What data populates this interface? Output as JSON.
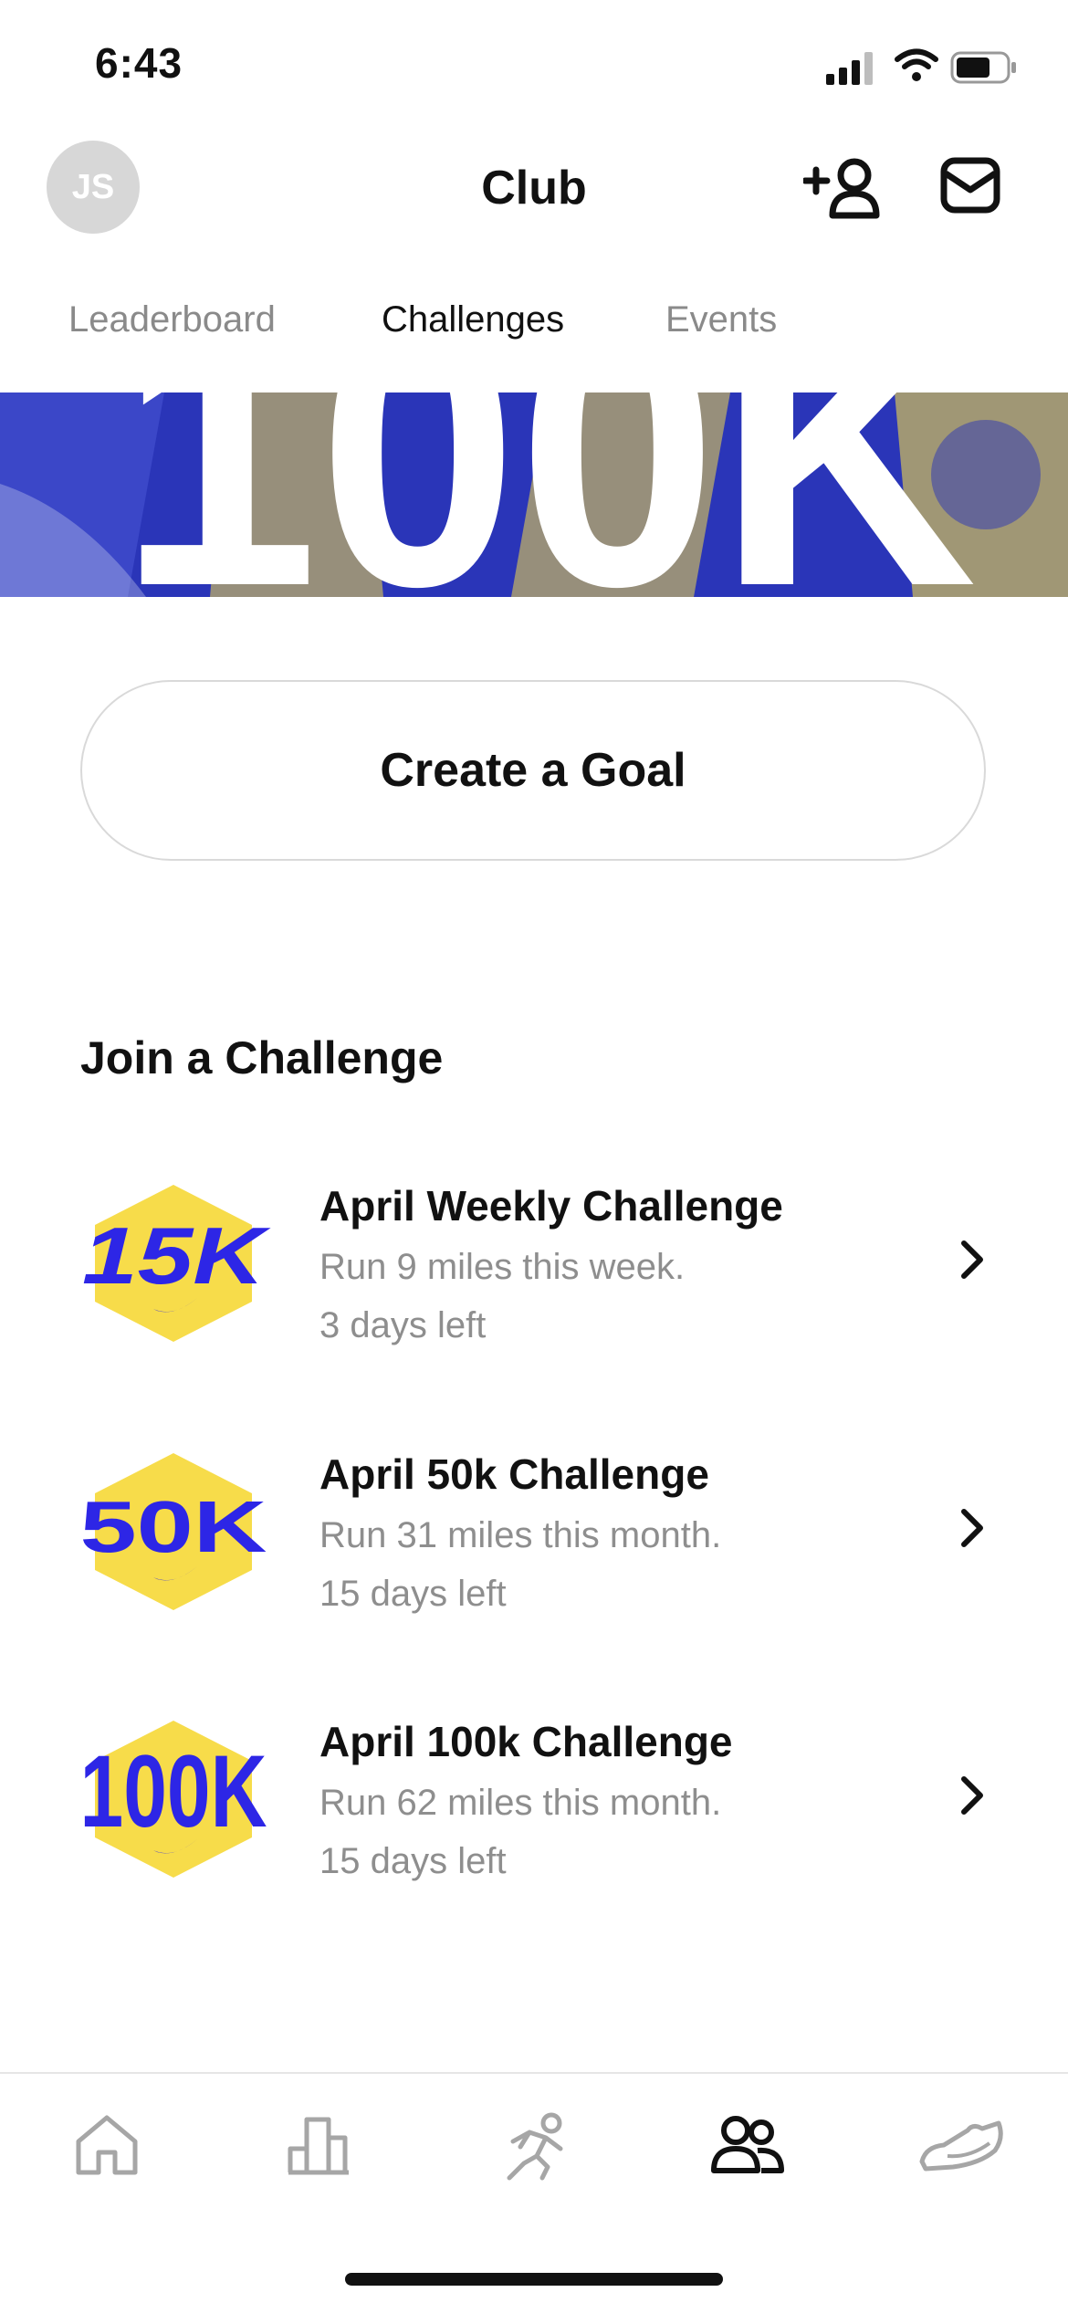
{
  "status_bar": {
    "time": "6:43"
  },
  "header": {
    "avatar_initials": "JS",
    "title": "Club"
  },
  "tabs": [
    {
      "label": "Leaderboard",
      "active": false
    },
    {
      "label": "Challenges",
      "active": true
    },
    {
      "label": "Events",
      "active": false
    }
  ],
  "banner": {
    "text": "100K"
  },
  "create_goal": {
    "label": "Create a Goal"
  },
  "join_section": {
    "heading": "Join a Challenge"
  },
  "challenges": [
    {
      "badge": "15K",
      "title": "April Weekly Challenge",
      "description": "Run 9 miles this week.",
      "time_left": "3 days left"
    },
    {
      "badge": "50K",
      "title": "April 50k Challenge",
      "description": "Run 31 miles this month.",
      "time_left": "15 days left"
    },
    {
      "badge": "100K",
      "title": "April 100k Challenge",
      "description": "Run 62 miles this month.",
      "time_left": "15 days left"
    }
  ],
  "bottom_nav": [
    {
      "icon": "home-icon",
      "active": false
    },
    {
      "icon": "activity-icon",
      "active": false
    },
    {
      "icon": "run-icon",
      "active": false
    },
    {
      "icon": "club-icon",
      "active": true
    },
    {
      "icon": "shoe-icon",
      "active": false
    }
  ],
  "colors": {
    "badge_yellow": "#f7dc4a",
    "badge_blue": "#2d26e6",
    "banner_blue": "#2a35b8",
    "muted": "#8e8e8e"
  }
}
